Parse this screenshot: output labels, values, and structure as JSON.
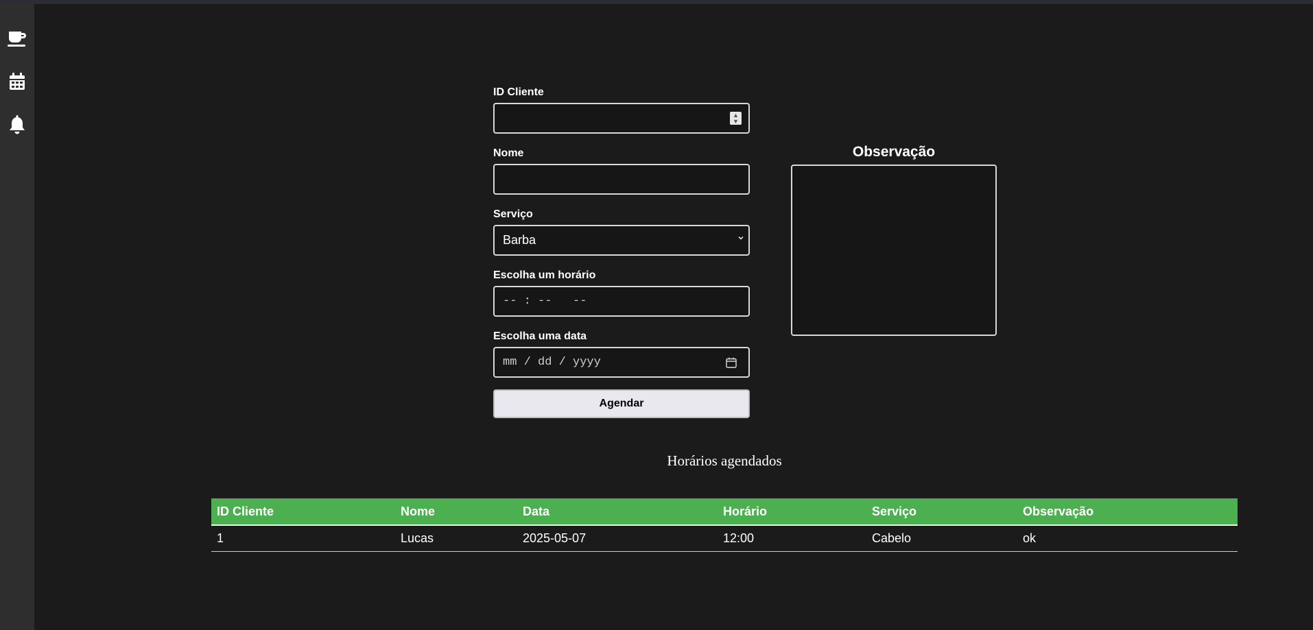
{
  "sidebar": {
    "items": [
      {
        "icon": "coffee-cup-icon"
      },
      {
        "icon": "calendar-icon"
      },
      {
        "icon": "bell-icon"
      }
    ]
  },
  "form": {
    "id_label": "ID Cliente",
    "id_value": "",
    "name_label": "Nome",
    "name_value": "",
    "service_label": "Serviço",
    "service_value": "Barba",
    "time_label": "Escolha um horário",
    "time_placeholder": "-- : --   --",
    "date_label": "Escolha uma data",
    "date_placeholder": "mm / dd / yyyy",
    "submit_label": "Agendar"
  },
  "observation": {
    "title": "Observação",
    "value": ""
  },
  "schedule": {
    "title": "Horários agendados",
    "accent_color": "#4caf50",
    "columns": [
      "ID Cliente",
      "Nome",
      "Data",
      "Horário",
      "Serviço",
      "Observação"
    ],
    "rows": [
      [
        "1",
        "Lucas",
        "2025-05-07",
        "12:00",
        "Cabelo",
        "ok"
      ]
    ]
  }
}
